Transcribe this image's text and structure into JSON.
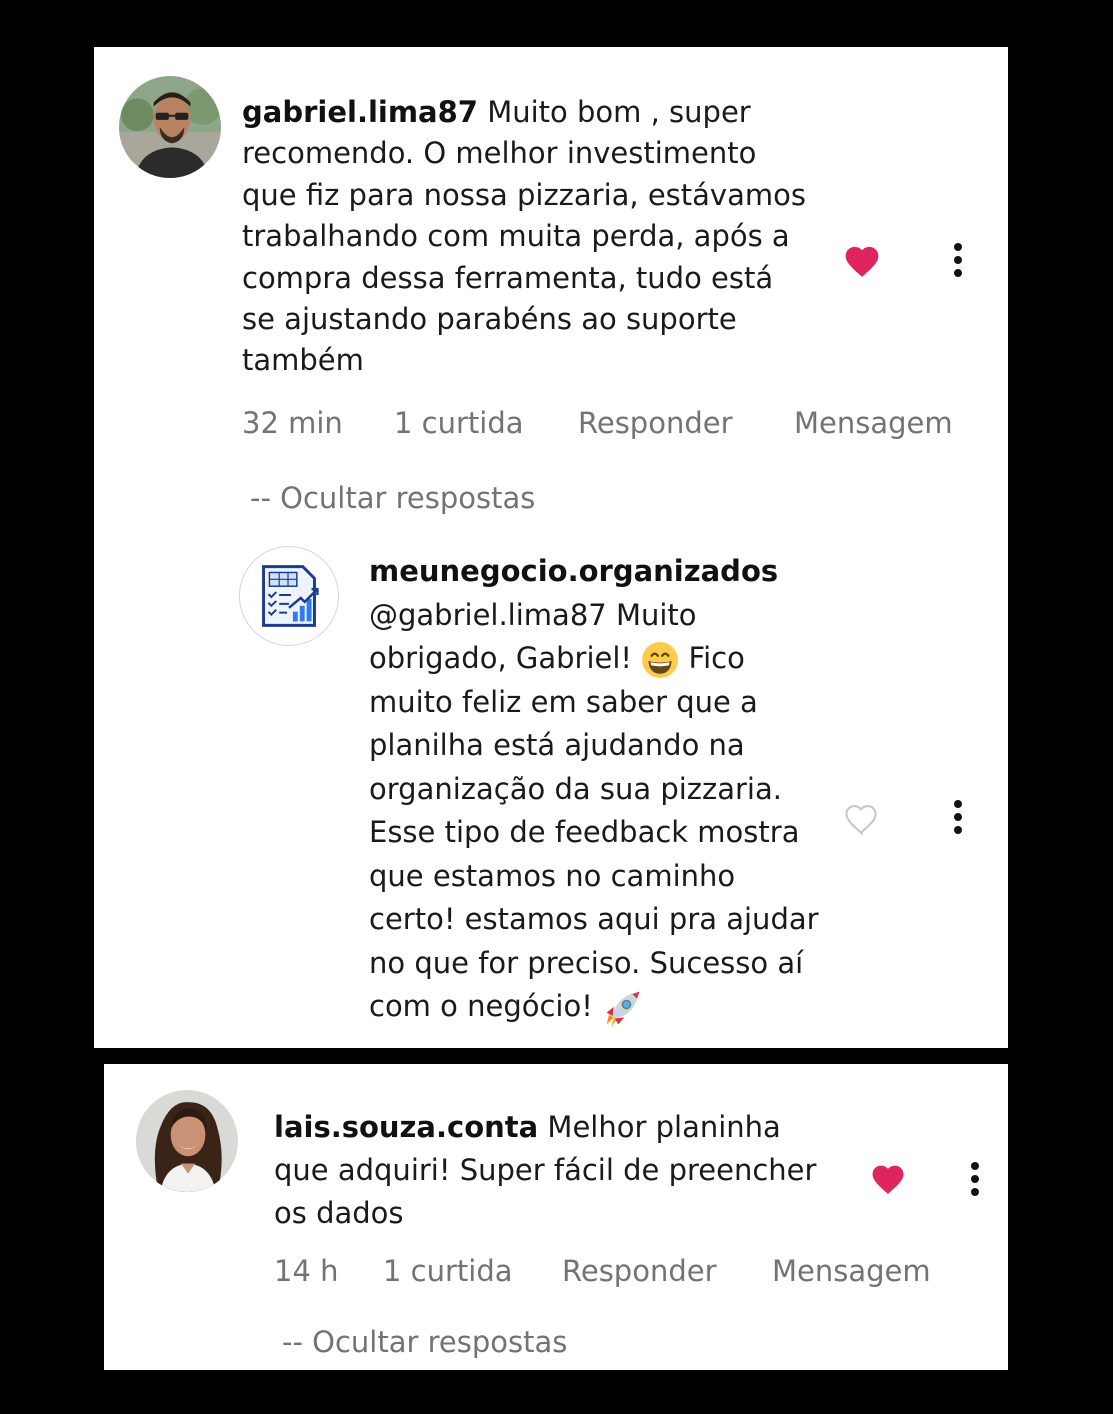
{
  "comments": [
    {
      "username": "gabriel.lima87",
      "text": " Muito bom , super recomendo. O melhor investimento que fiz para nossa pizzaria, estávamos trabalhando com muita perda, após a compra dessa ferramenta, tudo está se ajustando parabéns ao suporte também",
      "time": "32 min",
      "likes": "1 curtida",
      "reply_label": "Responder",
      "message_label": "Mensagem",
      "hide_replies": "-- Ocultar respostas",
      "liked": true,
      "heart_icon": "heart-filled-icon",
      "more_icon": "more-vertical-icon",
      "reply": {
        "username": "meunegocio.organizados",
        "text_1": " @gabriel.lima87 Muito obrigado, Gabriel! ",
        "emoji_1": "grinning-face-emoji",
        "text_2": " Fico muito feliz em saber que a planilha está ajudando na organização da sua pizzaria. Esse tipo de feedback mostra que estamos no caminho certo! estamos aqui pra ajudar no que for preciso. Sucesso aí com o negócio! ",
        "emoji_2": "rocket-emoji",
        "liked": false,
        "heart_icon": "heart-outline-icon",
        "more_icon": "more-vertical-icon"
      }
    },
    {
      "username": "lais.souza.conta",
      "text": " Melhor planinha que adquiri! Super fácil de preencher os dados",
      "time": "14 h",
      "likes": "1 curtida",
      "reply_label": "Responder",
      "message_label": "Mensagem",
      "hide_replies": "-- Ocultar respostas",
      "liked": true,
      "heart_icon": "heart-filled-icon",
      "more_icon": "more-vertical-icon"
    }
  ],
  "colors": {
    "background": "#000000",
    "card": "#ffffff",
    "heart": "#e0245e",
    "muted": "#737373"
  }
}
